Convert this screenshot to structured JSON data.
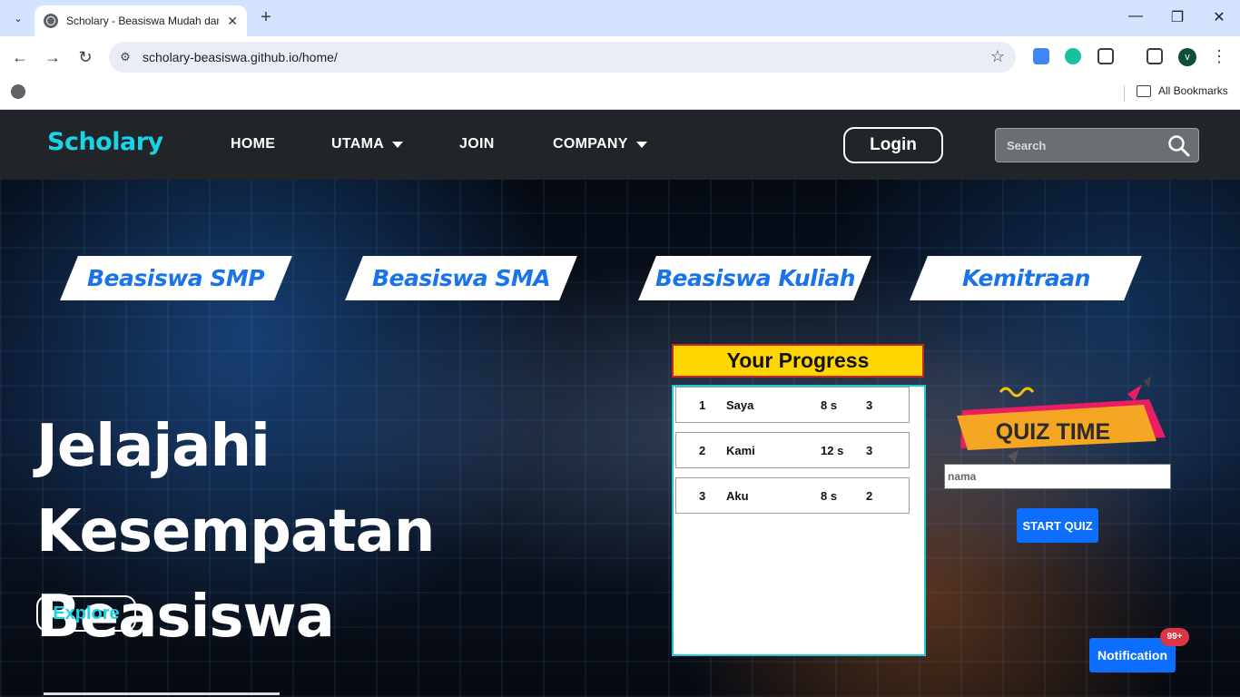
{
  "browser": {
    "tab_title": "Scholary - Beasiswa Mudah dan",
    "tab_close": "✕",
    "new_tab": "+",
    "url": "scholary-beasiswa.github.io/home/",
    "avatar_letter": "v",
    "all_bookmarks": "All Bookmarks",
    "window_controls": {
      "minimize": "—",
      "restore": "❐",
      "close": "✕"
    },
    "nav": {
      "back": "←",
      "forward": "→",
      "reload": "↻"
    },
    "star": "☆",
    "menu": "⋮"
  },
  "site": {
    "brand": "Scholary",
    "nav": [
      {
        "label": "HOME",
        "dropdown": false
      },
      {
        "label": "UTAMA",
        "dropdown": true
      },
      {
        "label": "JOIN",
        "dropdown": false
      },
      {
        "label": "COMPANY",
        "dropdown": true
      }
    ],
    "login_label": "Login",
    "search_placeholder": "Search"
  },
  "categories": [
    "Beasiswa SMP",
    "Beasiswa SMA",
    "Beasiswa Kuliah",
    "Kemitraan"
  ],
  "hero": {
    "title_line1": "Jelajahi Kesempatan",
    "title_line2": "Beasiswa",
    "explore_label": "Explore"
  },
  "progress": {
    "title": "Your Progress",
    "rows": [
      {
        "no": "1",
        "name": "Saya",
        "time": "8 s",
        "score": "3"
      },
      {
        "no": "2",
        "name": "Kami",
        "time": "12 s",
        "score": "3"
      },
      {
        "no": "3",
        "name": "Aku",
        "time": "8 s",
        "score": "2"
      }
    ]
  },
  "quiz": {
    "badge_text": "QUIZ TIME",
    "name_placeholder": "nama",
    "start_label": "START QUIZ"
  },
  "notification": {
    "label": "Notification",
    "badge": "99+"
  },
  "colors": {
    "accent_cyan": "#19d3e6",
    "nav_bg": "#212529",
    "primary_blue": "#0d6efd",
    "category_text": "#1a73e8",
    "progress_title_bg": "#ffd600",
    "quiz_badge": "#f5a623"
  }
}
